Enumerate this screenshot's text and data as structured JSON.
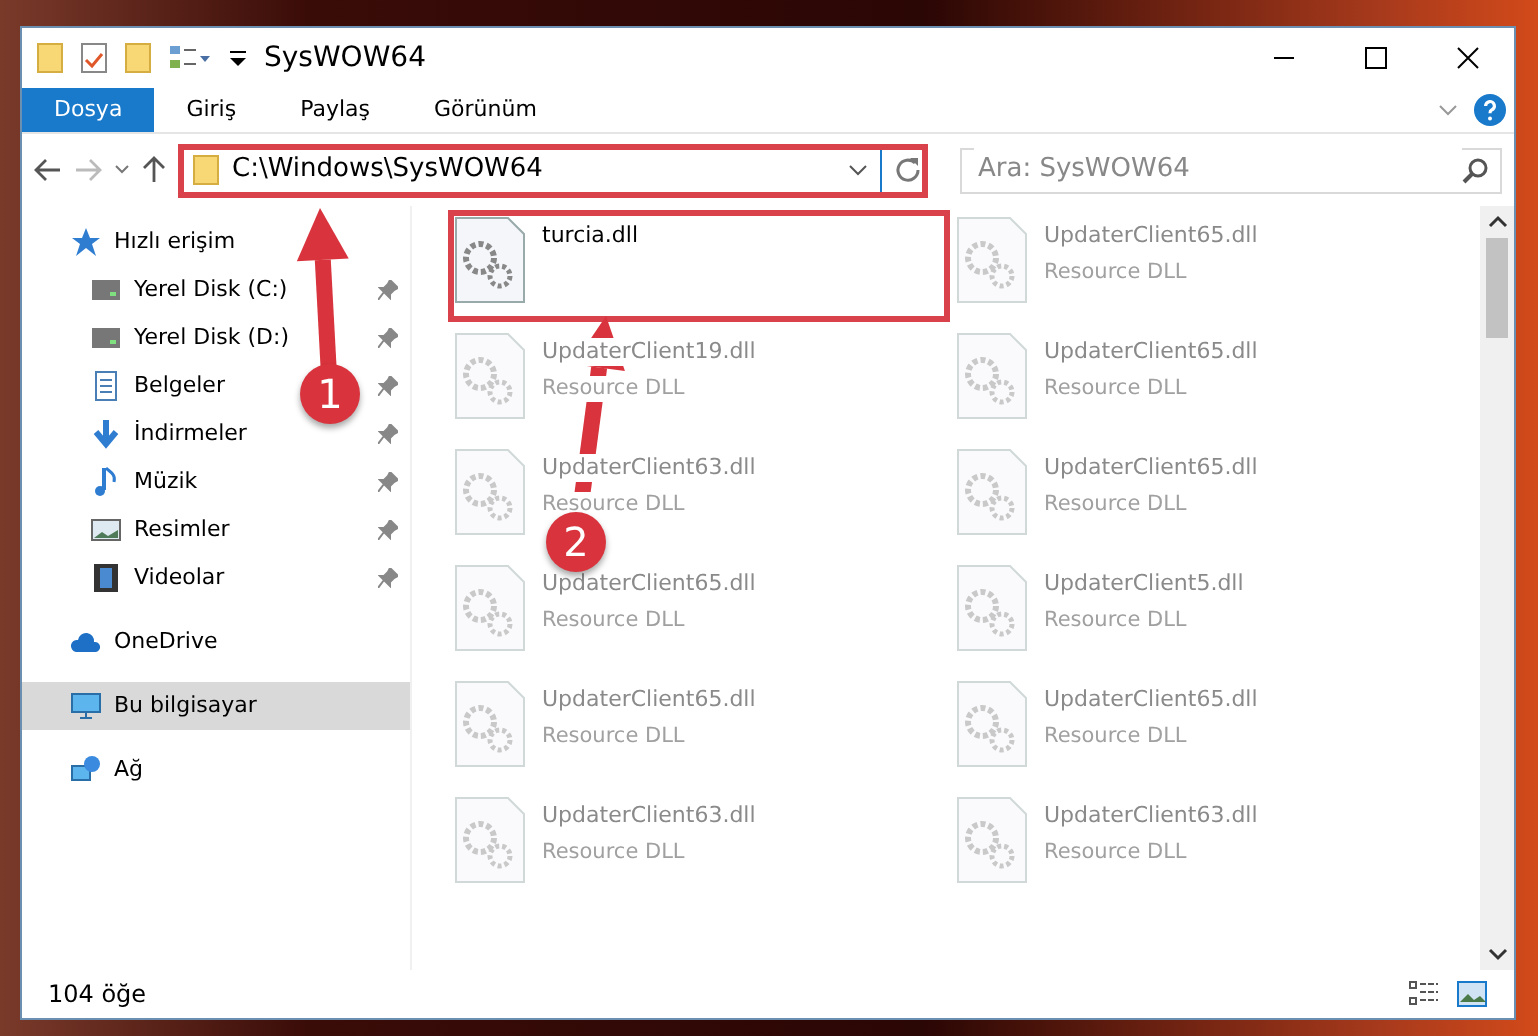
{
  "window": {
    "title": "SysWOW64"
  },
  "ribbon_tabs": [
    {
      "label": "Dosya",
      "selected": true
    },
    {
      "label": "Giriş",
      "selected": false
    },
    {
      "label": "Paylaş",
      "selected": false
    },
    {
      "label": "Görünüm",
      "selected": false
    }
  ],
  "address_bar": {
    "path": "C:\\Windows\\SysWOW64",
    "highlighted": true
  },
  "search": {
    "placeholder": "Ara: SysWOW64"
  },
  "sidebar": {
    "items": [
      {
        "label": "Hızlı erişim",
        "kind": "quick",
        "selected": false,
        "children": [
          {
            "label": "Yerel Disk (C:)",
            "kind": "disk",
            "pinned": true,
            "selected": false
          },
          {
            "label": "Yerel Disk (D:)",
            "kind": "disk",
            "pinned": true,
            "selected": false
          },
          {
            "label": "Belgeler",
            "kind": "docs",
            "pinned": true,
            "selected": false
          },
          {
            "label": "İndirmeler",
            "kind": "download",
            "pinned": true,
            "selected": false
          },
          {
            "label": "Müzik",
            "kind": "music",
            "pinned": true,
            "selected": false
          },
          {
            "label": "Resimler",
            "kind": "pictures",
            "pinned": true,
            "selected": false
          },
          {
            "label": "Videolar",
            "kind": "videos",
            "pinned": true,
            "selected": false
          }
        ]
      },
      {
        "label": "OneDrive",
        "kind": "cloud",
        "selected": false
      },
      {
        "label": "Bu bilgisayar",
        "kind": "pc",
        "selected": true
      },
      {
        "label": "Ağ",
        "kind": "network",
        "selected": false
      }
    ]
  },
  "files": [
    {
      "name": "turcia.dll",
      "highlighted": true
    },
    {
      "name": "UpdaterClient65.dll",
      "type": "Resource DLL",
      "highlighted": false
    },
    {
      "name": "UpdaterClient19.dll",
      "type": "Resource DLL",
      "highlighted": false
    },
    {
      "name": "UpdaterClient65.dll",
      "type": "Resource DLL",
      "highlighted": false
    },
    {
      "name": "UpdaterClient63.dll",
      "type": "Resource DLL",
      "highlighted": false
    },
    {
      "name": "UpdaterClient65.dll",
      "type": "Resource DLL",
      "highlighted": false
    },
    {
      "name": "UpdaterClient65.dll",
      "type": "Resource DLL",
      "highlighted": false
    },
    {
      "name": "UpdaterClient5.dll",
      "type": "Resource DLL",
      "highlighted": false
    },
    {
      "name": "UpdaterClient65.dll",
      "type": "Resource DLL",
      "highlighted": false
    },
    {
      "name": "UpdaterClient65.dll",
      "type": "Resource DLL",
      "highlighted": false
    },
    {
      "name": "UpdaterClient63.dll",
      "type": "Resource DLL",
      "highlighted": false
    },
    {
      "name": "UpdaterClient63.dll",
      "type": "Resource DLL",
      "highlighted": false
    }
  ],
  "status_bar": {
    "item_count": "104 öğe"
  },
  "annotations": [
    {
      "number": "1"
    },
    {
      "number": "2"
    }
  ]
}
